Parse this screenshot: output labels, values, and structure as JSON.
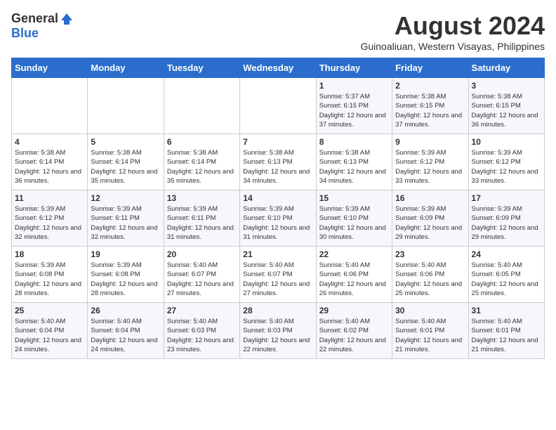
{
  "logo": {
    "general": "General",
    "blue": "Blue"
  },
  "title": "August 2024",
  "subtitle": "Guinoaliuan, Western Visayas, Philippines",
  "weekdays": [
    "Sunday",
    "Monday",
    "Tuesday",
    "Wednesday",
    "Thursday",
    "Friday",
    "Saturday"
  ],
  "weeks": [
    [
      {
        "day": "",
        "content": ""
      },
      {
        "day": "",
        "content": ""
      },
      {
        "day": "",
        "content": ""
      },
      {
        "day": "",
        "content": ""
      },
      {
        "day": "1",
        "content": "Sunrise: 5:37 AM\nSunset: 6:15 PM\nDaylight: 12 hours\nand 37 minutes."
      },
      {
        "day": "2",
        "content": "Sunrise: 5:38 AM\nSunset: 6:15 PM\nDaylight: 12 hours\nand 37 minutes."
      },
      {
        "day": "3",
        "content": "Sunrise: 5:38 AM\nSunset: 6:15 PM\nDaylight: 12 hours\nand 36 minutes."
      }
    ],
    [
      {
        "day": "4",
        "content": "Sunrise: 5:38 AM\nSunset: 6:14 PM\nDaylight: 12 hours\nand 36 minutes."
      },
      {
        "day": "5",
        "content": "Sunrise: 5:38 AM\nSunset: 6:14 PM\nDaylight: 12 hours\nand 35 minutes."
      },
      {
        "day": "6",
        "content": "Sunrise: 5:38 AM\nSunset: 6:14 PM\nDaylight: 12 hours\nand 35 minutes."
      },
      {
        "day": "7",
        "content": "Sunrise: 5:38 AM\nSunset: 6:13 PM\nDaylight: 12 hours\nand 34 minutes."
      },
      {
        "day": "8",
        "content": "Sunrise: 5:38 AM\nSunset: 6:13 PM\nDaylight: 12 hours\nand 34 minutes."
      },
      {
        "day": "9",
        "content": "Sunrise: 5:39 AM\nSunset: 6:12 PM\nDaylight: 12 hours\nand 33 minutes."
      },
      {
        "day": "10",
        "content": "Sunrise: 5:39 AM\nSunset: 6:12 PM\nDaylight: 12 hours\nand 33 minutes."
      }
    ],
    [
      {
        "day": "11",
        "content": "Sunrise: 5:39 AM\nSunset: 6:12 PM\nDaylight: 12 hours\nand 32 minutes."
      },
      {
        "day": "12",
        "content": "Sunrise: 5:39 AM\nSunset: 6:11 PM\nDaylight: 12 hours\nand 32 minutes."
      },
      {
        "day": "13",
        "content": "Sunrise: 5:39 AM\nSunset: 6:11 PM\nDaylight: 12 hours\nand 31 minutes."
      },
      {
        "day": "14",
        "content": "Sunrise: 5:39 AM\nSunset: 6:10 PM\nDaylight: 12 hours\nand 31 minutes."
      },
      {
        "day": "15",
        "content": "Sunrise: 5:39 AM\nSunset: 6:10 PM\nDaylight: 12 hours\nand 30 minutes."
      },
      {
        "day": "16",
        "content": "Sunrise: 5:39 AM\nSunset: 6:09 PM\nDaylight: 12 hours\nand 29 minutes."
      },
      {
        "day": "17",
        "content": "Sunrise: 5:39 AM\nSunset: 6:09 PM\nDaylight: 12 hours\nand 29 minutes."
      }
    ],
    [
      {
        "day": "18",
        "content": "Sunrise: 5:39 AM\nSunset: 6:08 PM\nDaylight: 12 hours\nand 28 minutes."
      },
      {
        "day": "19",
        "content": "Sunrise: 5:39 AM\nSunset: 6:08 PM\nDaylight: 12 hours\nand 28 minutes."
      },
      {
        "day": "20",
        "content": "Sunrise: 5:40 AM\nSunset: 6:07 PM\nDaylight: 12 hours\nand 27 minutes."
      },
      {
        "day": "21",
        "content": "Sunrise: 5:40 AM\nSunset: 6:07 PM\nDaylight: 12 hours\nand 27 minutes."
      },
      {
        "day": "22",
        "content": "Sunrise: 5:40 AM\nSunset: 6:06 PM\nDaylight: 12 hours\nand 26 minutes."
      },
      {
        "day": "23",
        "content": "Sunrise: 5:40 AM\nSunset: 6:06 PM\nDaylight: 12 hours\nand 25 minutes."
      },
      {
        "day": "24",
        "content": "Sunrise: 5:40 AM\nSunset: 6:05 PM\nDaylight: 12 hours\nand 25 minutes."
      }
    ],
    [
      {
        "day": "25",
        "content": "Sunrise: 5:40 AM\nSunset: 6:04 PM\nDaylight: 12 hours\nand 24 minutes."
      },
      {
        "day": "26",
        "content": "Sunrise: 5:40 AM\nSunset: 6:04 PM\nDaylight: 12 hours\nand 24 minutes."
      },
      {
        "day": "27",
        "content": "Sunrise: 5:40 AM\nSunset: 6:03 PM\nDaylight: 12 hours\nand 23 minutes."
      },
      {
        "day": "28",
        "content": "Sunrise: 5:40 AM\nSunset: 6:03 PM\nDaylight: 12 hours\nand 22 minutes."
      },
      {
        "day": "29",
        "content": "Sunrise: 5:40 AM\nSunset: 6:02 PM\nDaylight: 12 hours\nand 22 minutes."
      },
      {
        "day": "30",
        "content": "Sunrise: 5:40 AM\nSunset: 6:01 PM\nDaylight: 12 hours\nand 21 minutes."
      },
      {
        "day": "31",
        "content": "Sunrise: 5:40 AM\nSunset: 6:01 PM\nDaylight: 12 hours\nand 21 minutes."
      }
    ]
  ]
}
